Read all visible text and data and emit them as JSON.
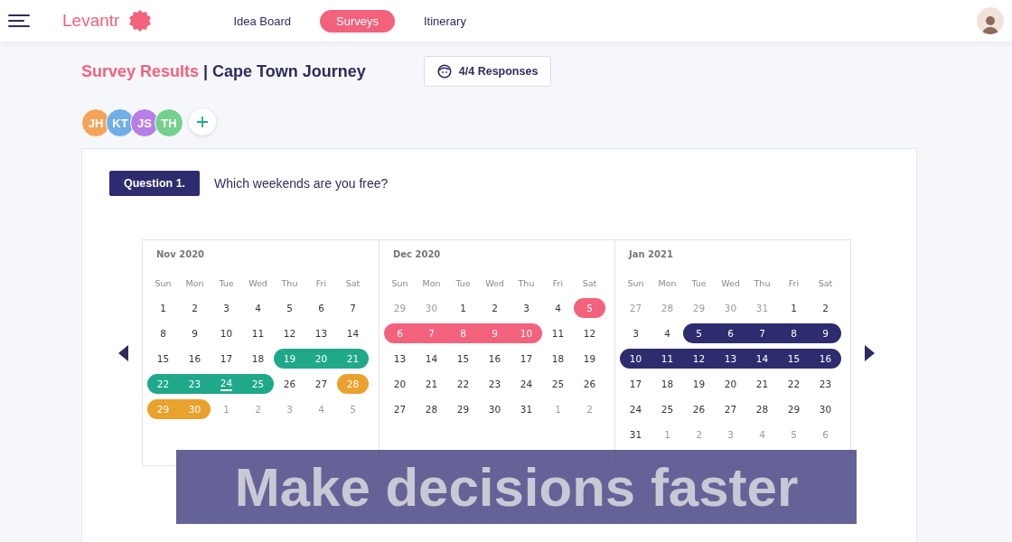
{
  "header": {
    "brand": "Levantr",
    "tabs": [
      {
        "label": "Idea Board",
        "selected": false
      },
      {
        "label": "Surveys",
        "selected": true
      },
      {
        "label": "Itinerary",
        "selected": false
      }
    ]
  },
  "title": {
    "section": "Survey Results",
    "separator": "|",
    "name": "Cape Town Journey"
  },
  "responses": "4/4 Responses",
  "participants": [
    {
      "initials": "JH",
      "color": "#f4a45a"
    },
    {
      "initials": "KT",
      "color": "#72aee6"
    },
    {
      "initials": "JS",
      "color": "#b77ee3"
    },
    {
      "initials": "TH",
      "color": "#74d08f"
    }
  ],
  "question": {
    "badge": "Question 1.",
    "text": "Which weekends are you free?"
  },
  "months": [
    {
      "label": "Nov 2020",
      "weekdays": [
        "Sun",
        "Mon",
        "Tue",
        "Wed",
        "Thu",
        "Fri",
        "Sat"
      ],
      "days": [
        {
          "label": "1",
          "muted": false,
          "today": false
        },
        {
          "label": "2",
          "muted": false,
          "today": false
        },
        {
          "label": "3",
          "muted": false,
          "today": false
        },
        {
          "label": "4",
          "muted": false,
          "today": false
        },
        {
          "label": "5",
          "muted": false,
          "today": false
        },
        {
          "label": "6",
          "muted": false,
          "today": false
        },
        {
          "label": "7",
          "muted": false,
          "today": false
        },
        {
          "label": "8",
          "muted": false,
          "today": false
        },
        {
          "label": "9",
          "muted": false,
          "today": false
        },
        {
          "label": "10",
          "muted": false,
          "today": false
        },
        {
          "label": "11",
          "muted": false,
          "today": false
        },
        {
          "label": "12",
          "muted": false,
          "today": false
        },
        {
          "label": "13",
          "muted": false,
          "today": false
        },
        {
          "label": "14",
          "muted": false,
          "today": false
        },
        {
          "label": "15",
          "muted": false,
          "today": false
        },
        {
          "label": "16",
          "muted": false,
          "today": false
        },
        {
          "label": "17",
          "muted": false,
          "today": false
        },
        {
          "label": "18",
          "muted": false,
          "today": false
        },
        {
          "label": "19",
          "muted": false,
          "today": false,
          "color": "#1fa98a"
        },
        {
          "label": "20",
          "muted": false,
          "today": false,
          "color": "#1fa98a"
        },
        {
          "label": "21",
          "muted": false,
          "today": false,
          "color": "#1fa98a"
        },
        {
          "label": "22",
          "muted": false,
          "today": false,
          "color": "#1fa98a"
        },
        {
          "label": "23",
          "muted": false,
          "today": false,
          "color": "#1fa98a"
        },
        {
          "label": "24",
          "muted": false,
          "today": true,
          "color": "#1fa98a"
        },
        {
          "label": "25",
          "muted": false,
          "today": false,
          "color": "#1fa98a"
        },
        {
          "label": "26",
          "muted": false,
          "today": false
        },
        {
          "label": "27",
          "muted": false,
          "today": false
        },
        {
          "label": "28",
          "muted": false,
          "today": false,
          "color": "#e9a22d"
        },
        {
          "label": "29",
          "muted": false,
          "today": false,
          "color": "#e9a22d"
        },
        {
          "label": "30",
          "muted": false,
          "today": false,
          "color": "#e9a22d"
        },
        {
          "label": "1",
          "muted": true,
          "today": false
        },
        {
          "label": "2",
          "muted": true,
          "today": false
        },
        {
          "label": "3",
          "muted": true,
          "today": false
        },
        {
          "label": "4",
          "muted": true,
          "today": false
        },
        {
          "label": "5",
          "muted": true,
          "today": false
        }
      ]
    },
    {
      "label": "Dec 2020",
      "weekdays": [
        "Sun",
        "Mon",
        "Tue",
        "Wed",
        "Thu",
        "Fri",
        "Sat"
      ],
      "days": [
        {
          "label": "29",
          "muted": true,
          "today": false
        },
        {
          "label": "30",
          "muted": true,
          "today": false
        },
        {
          "label": "1",
          "muted": false,
          "today": false
        },
        {
          "label": "2",
          "muted": false,
          "today": false
        },
        {
          "label": "3",
          "muted": false,
          "today": false
        },
        {
          "label": "4",
          "muted": false,
          "today": false
        },
        {
          "label": "5",
          "muted": false,
          "today": false,
          "color": "#f2627c"
        },
        {
          "label": "6",
          "muted": false,
          "today": false,
          "color": "#f2627c"
        },
        {
          "label": "7",
          "muted": false,
          "today": false,
          "color": "#f2627c"
        },
        {
          "label": "8",
          "muted": false,
          "today": false,
          "color": "#f2627c"
        },
        {
          "label": "9",
          "muted": false,
          "today": false,
          "color": "#f2627c"
        },
        {
          "label": "10",
          "muted": false,
          "today": false,
          "color": "#f2627c"
        },
        {
          "label": "11",
          "muted": false,
          "today": false
        },
        {
          "label": "12",
          "muted": false,
          "today": false
        },
        {
          "label": "13",
          "muted": false,
          "today": false
        },
        {
          "label": "14",
          "muted": false,
          "today": false
        },
        {
          "label": "15",
          "muted": false,
          "today": false
        },
        {
          "label": "16",
          "muted": false,
          "today": false
        },
        {
          "label": "17",
          "muted": false,
          "today": false
        },
        {
          "label": "18",
          "muted": false,
          "today": false
        },
        {
          "label": "19",
          "muted": false,
          "today": false
        },
        {
          "label": "20",
          "muted": false,
          "today": false
        },
        {
          "label": "21",
          "muted": false,
          "today": false
        },
        {
          "label": "22",
          "muted": false,
          "today": false
        },
        {
          "label": "23",
          "muted": false,
          "today": false
        },
        {
          "label": "24",
          "muted": false,
          "today": false
        },
        {
          "label": "25",
          "muted": false,
          "today": false
        },
        {
          "label": "26",
          "muted": false,
          "today": false
        },
        {
          "label": "27",
          "muted": false,
          "today": false
        },
        {
          "label": "28",
          "muted": false,
          "today": false
        },
        {
          "label": "29",
          "muted": false,
          "today": false
        },
        {
          "label": "30",
          "muted": false,
          "today": false
        },
        {
          "label": "31",
          "muted": false,
          "today": false
        },
        {
          "label": "1",
          "muted": true,
          "today": false
        },
        {
          "label": "2",
          "muted": true,
          "today": false
        }
      ]
    },
    {
      "label": "Jan 2021",
      "weekdays": [
        "Sun",
        "Mon",
        "Tue",
        "Wed",
        "Thu",
        "Fri",
        "Sat"
      ],
      "days": [
        {
          "label": "27",
          "muted": true,
          "today": false
        },
        {
          "label": "28",
          "muted": true,
          "today": false
        },
        {
          "label": "29",
          "muted": true,
          "today": false
        },
        {
          "label": "30",
          "muted": true,
          "today": false
        },
        {
          "label": "31",
          "muted": true,
          "today": false
        },
        {
          "label": "1",
          "muted": false,
          "today": false
        },
        {
          "label": "2",
          "muted": false,
          "today": false
        },
        {
          "label": "3",
          "muted": false,
          "today": false
        },
        {
          "label": "4",
          "muted": false,
          "today": false
        },
        {
          "label": "5",
          "muted": false,
          "today": false,
          "color": "#2e2c6e"
        },
        {
          "label": "6",
          "muted": false,
          "today": false,
          "color": "#2e2c6e"
        },
        {
          "label": "7",
          "muted": false,
          "today": false,
          "color": "#2e2c6e"
        },
        {
          "label": "8",
          "muted": false,
          "today": false,
          "color": "#2e2c6e"
        },
        {
          "label": "9",
          "muted": false,
          "today": false,
          "color": "#2e2c6e"
        },
        {
          "label": "10",
          "muted": false,
          "today": false,
          "color": "#2e2c6e"
        },
        {
          "label": "11",
          "muted": false,
          "today": false,
          "color": "#2e2c6e"
        },
        {
          "label": "12",
          "muted": false,
          "today": false,
          "color": "#2e2c6e"
        },
        {
          "label": "13",
          "muted": false,
          "today": false,
          "color": "#2e2c6e"
        },
        {
          "label": "14",
          "muted": false,
          "today": false,
          "color": "#2e2c6e"
        },
        {
          "label": "15",
          "muted": false,
          "today": false,
          "color": "#2e2c6e"
        },
        {
          "label": "16",
          "muted": false,
          "today": false,
          "color": "#2e2c6e"
        },
        {
          "label": "17",
          "muted": false,
          "today": false
        },
        {
          "label": "18",
          "muted": false,
          "today": false
        },
        {
          "label": "19",
          "muted": false,
          "today": false
        },
        {
          "label": "20",
          "muted": false,
          "today": false
        },
        {
          "label": "21",
          "muted": false,
          "today": false
        },
        {
          "label": "22",
          "muted": false,
          "today": false
        },
        {
          "label": "23",
          "muted": false,
          "today": false
        },
        {
          "label": "24",
          "muted": false,
          "today": false
        },
        {
          "label": "25",
          "muted": false,
          "today": false
        },
        {
          "label": "26",
          "muted": false,
          "today": false
        },
        {
          "label": "27",
          "muted": false,
          "today": false
        },
        {
          "label": "28",
          "muted": false,
          "today": false
        },
        {
          "label": "29",
          "muted": false,
          "today": false
        },
        {
          "label": "30",
          "muted": false,
          "today": false
        },
        {
          "label": "31",
          "muted": false,
          "today": false
        },
        {
          "label": "1",
          "muted": true,
          "today": false
        },
        {
          "label": "2",
          "muted": true,
          "today": false
        },
        {
          "label": "3",
          "muted": true,
          "today": false
        },
        {
          "label": "4",
          "muted": true,
          "today": false
        },
        {
          "label": "5",
          "muted": true,
          "today": false
        },
        {
          "label": "6",
          "muted": true,
          "today": false
        }
      ]
    }
  ],
  "caption": "Make decisions faster"
}
